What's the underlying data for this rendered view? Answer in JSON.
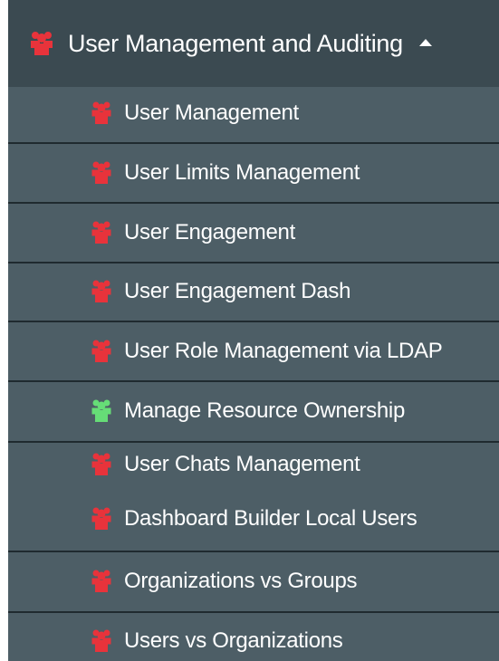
{
  "menu": {
    "header": {
      "label": "User Management and Auditing",
      "icon": "users-group-icon",
      "expanded_indicator": "caret-up-icon",
      "icon_color": "#e8333b"
    },
    "items": [
      {
        "label": "User Management",
        "icon": "users-group-icon",
        "icon_color": "#e8333b"
      },
      {
        "label": "User Limits Management",
        "icon": "users-group-icon",
        "icon_color": "#e8333b"
      },
      {
        "label": "User Engagement",
        "icon": "users-group-icon",
        "icon_color": "#e8333b"
      },
      {
        "label": "User Engagement Dash",
        "icon": "users-group-icon",
        "icon_color": "#e8333b"
      },
      {
        "label": "User Role Management via LDAP",
        "icon": "users-group-icon",
        "icon_color": "#e8333b"
      },
      {
        "label": "Manage Resource Ownership",
        "icon": "users-group-icon",
        "icon_color": "#66dd77"
      },
      {
        "label": "User Chats Management",
        "icon": "users-group-icon",
        "icon_color": "#e8333b"
      },
      {
        "label": "Dashboard Builder Local Users",
        "icon": "users-group-icon",
        "icon_color": "#e8333b"
      },
      {
        "label": "Organizations vs Groups",
        "icon": "users-group-icon",
        "icon_color": "#e8333b"
      },
      {
        "label": "Users vs Organizations",
        "icon": "users-group-icon",
        "icon_color": "#e8333b"
      }
    ]
  }
}
